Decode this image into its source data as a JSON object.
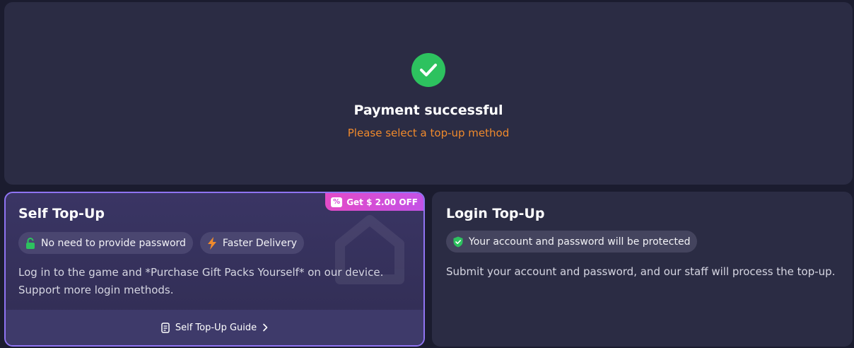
{
  "status": {
    "title": "Payment successful",
    "subtitle": "Please select a top-up method",
    "icon": "check-circle-icon",
    "icon_color": "#2dc25f",
    "subtitle_color": "#f08a2c"
  },
  "self_topup": {
    "title": "Self Top-Up",
    "discount_badge": "Get $ 2.00 OFF",
    "tags": [
      {
        "icon": "lock-icon",
        "label": "No need to provide password"
      },
      {
        "icon": "lightning-icon",
        "label": "Faster Delivery"
      }
    ],
    "description": "Log in to the game and *Purchase Gift Packs Yourself* on our device. Support more login methods.",
    "guide_link": "Self Top-Up Guide",
    "accent_color": "#8f74f2"
  },
  "login_topup": {
    "title": "Login Top-Up",
    "tags": [
      {
        "icon": "shield-check-icon",
        "label": "Your account and password will be protected"
      }
    ],
    "description": "Submit your account and password, and our staff will process the top-up."
  }
}
